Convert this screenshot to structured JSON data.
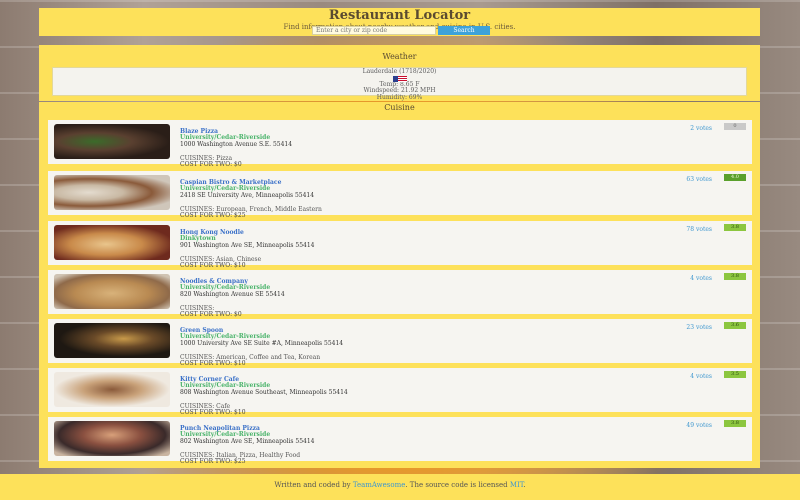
{
  "header": {
    "title": "Restaurant Locator",
    "subtitle": "Find information about nearby weather and cuisine in U.S. cities.",
    "search_placeholder": "Enter a city or zip code",
    "search_button": "Search"
  },
  "weather": {
    "section_title": "Weather",
    "location": "Lauderdale (1718/2020)",
    "flag_icon": "us-flag-icon",
    "temp": "Temp: 8.65 F",
    "windspeed": "Windspeed: 21.92 MPH",
    "humidity": "Humidity: 69%"
  },
  "cuisine": {
    "section_title": "Cuisine",
    "restaurants": [
      {
        "name": "Blaze Pizza",
        "locality": "University/Cedar-Riverside",
        "address": "1000 Washington Avenue S.E. 55414",
        "cuisines": "CUISINES: Pizza",
        "cost": "COST FOR TWO: $0",
        "votes": "2 votes",
        "rating": "0",
        "image_icon": "salad-photo"
      },
      {
        "name": "Caspian Bistro & Marketplace",
        "locality": "University/Cedar-Riverside",
        "address": "2418 SE University Ave, Minneapolis 55414",
        "cuisines": "CUISINES: European, French, Middle Eastern",
        "cost": "COST FOR TWO: $25",
        "votes": "63 votes",
        "rating": "4.0",
        "image_icon": "plated-food-photo"
      },
      {
        "name": "Hong Kong Noodle",
        "locality": "Dinkytown",
        "address": "901 Washington Ave SE, Minneapolis 55414",
        "cuisines": "CUISINES: Asian, Chinese",
        "cost": "COST FOR TWO: $10",
        "votes": "78 votes",
        "rating": "3.8",
        "image_icon": "noodle-bowl-photo"
      },
      {
        "name": "Noodles & Company",
        "locality": "University/Cedar-Riverside",
        "address": "820 Washington Avenue SE 55414",
        "cuisines": "CUISINES:",
        "cost": "COST FOR TWO: $0",
        "votes": "4 votes",
        "rating": "3.8",
        "image_icon": "dumplings-photo"
      },
      {
        "name": "Green Spoon",
        "locality": "University/Cedar-Riverside",
        "address": "1000 University Ave SE Suite #A, Minneapolis 55414",
        "cuisines": "CUISINES: American, Coffee and Tea, Korean",
        "cost": "COST FOR TWO: $10",
        "votes": "23 votes",
        "rating": "3.6",
        "image_icon": "cafe-interior-photo"
      },
      {
        "name": "Kitty Corner Cafe",
        "locality": "University/Cedar-Riverside",
        "address": "808 Washington Avenue Southeast, Minneapolis 55414",
        "cuisines": "CUISINES: Cafe",
        "cost": "COST FOR TWO: $10",
        "votes": "4 votes",
        "rating": "3.5",
        "image_icon": "pastry-tray-photo"
      },
      {
        "name": "Punch Neapolitan Pizza",
        "locality": "University/Cedar-Riverside",
        "address": "802 Washington Ave SE, Minneapolis 55414",
        "cuisines": "CUISINES: Italian, Pizza, Healthy Food",
        "cost": "COST FOR TWO: $25",
        "votes": "49 votes",
        "rating": "3.8",
        "image_icon": "pizza-chef-photo"
      }
    ]
  },
  "footer": {
    "prefix": "Written and coded by ",
    "team": "TeamAwesome",
    "middle": ". The source code is licensed ",
    "license": "MIT",
    "suffix": "."
  },
  "colors": {
    "panel": "#fde15a",
    "accent_blue": "#3ea2d9",
    "rating_green": "#8cc63f",
    "locality_green": "#49b36a"
  }
}
